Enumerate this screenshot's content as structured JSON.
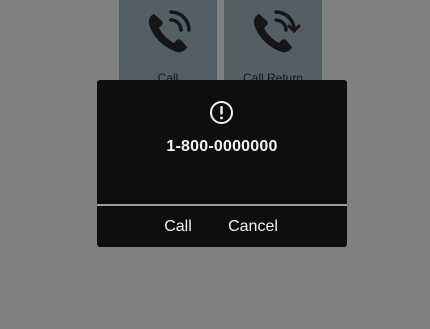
{
  "background": {
    "tiles": [
      {
        "label": "Call",
        "icon": "phone-ringing-icon"
      },
      {
        "label": "Call Return",
        "icon": "phone-return-icon"
      }
    ]
  },
  "dialog": {
    "icon": "alert-circle-icon",
    "phone_number": "1-800-0000000",
    "buttons": {
      "call_label": "Call",
      "cancel_label": "Cancel"
    }
  },
  "colors": {
    "dialog_background": "#0e0e0e",
    "dialog_text": "#f2f2f2",
    "tile_background": "#9bb5bf",
    "divider": "#9a9a9a"
  }
}
